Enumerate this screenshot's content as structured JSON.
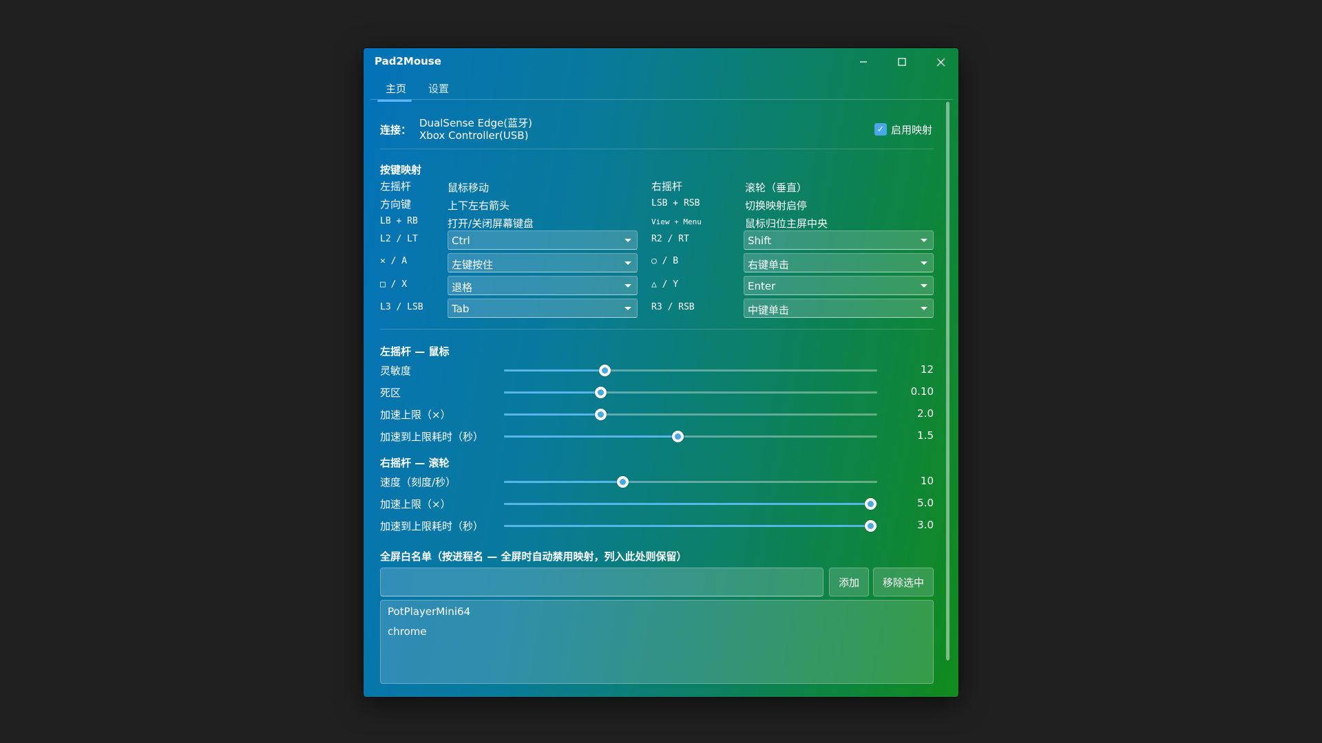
{
  "window": {
    "title": "Pad2Mouse"
  },
  "tabs": [
    {
      "label": "主页"
    },
    {
      "label": "设置"
    }
  ],
  "connection": {
    "label": "连接：",
    "devices": [
      "DualSense Edge(蓝牙)",
      "Xbox Controller(USB)"
    ],
    "enable_label": "启用映射",
    "enabled": true
  },
  "mapping": {
    "title": "按键映射",
    "static": [
      {
        "key": "左摇杆",
        "action": "鼠标移动"
      },
      {
        "key": "方向键",
        "action": "上下左右箭头"
      },
      {
        "key": "LB + RB",
        "action": "打开/关闭屏幕键盘"
      },
      {
        "key": "右摇杆",
        "action": "滚轮（垂直）"
      },
      {
        "key": "LSB + RSB",
        "action": "切换映射启停"
      },
      {
        "key": "View + Menu",
        "action": "鼠标归位主屏中央"
      }
    ],
    "selects": [
      {
        "key": "L2 / LT",
        "value": "Ctrl"
      },
      {
        "key": "✕ / A",
        "value": "左键按住"
      },
      {
        "key": "□ / X",
        "value": "退格"
      },
      {
        "key": "L3 / LSB",
        "value": "Tab"
      },
      {
        "key": "R2 / RT",
        "value": "Shift"
      },
      {
        "key": "○ / B",
        "value": "右键单击"
      },
      {
        "key": "△ / Y",
        "value": "Enter"
      },
      {
        "key": "R3 / RSB",
        "value": "中键单击"
      }
    ]
  },
  "left_stick": {
    "title": "左摇杆 — 鼠标",
    "sliders": [
      {
        "label": "灵敏度",
        "value": "12",
        "fraction": 0.27
      },
      {
        "label": "死区",
        "value": "0.10",
        "fraction": 0.258
      },
      {
        "label": "加速上限（×）",
        "value": "2.0",
        "fraction": 0.258
      },
      {
        "label": "加速到上限耗时（秒）",
        "value": "1.5",
        "fraction": 0.465
      }
    ]
  },
  "right_stick": {
    "title": "右摇杆 — 滚轮",
    "sliders": [
      {
        "label": "速度（刻度/秒）",
        "value": "10",
        "fraction": 0.317
      },
      {
        "label": "加速上限（×）",
        "value": "5.0",
        "fraction": 0.982
      },
      {
        "label": "加速到上限耗时（秒）",
        "value": "3.0",
        "fraction": 0.982
      }
    ]
  },
  "whitelist": {
    "title": "全屏白名单（按进程名 — 全屏时自动禁用映射，列入此处则保留）",
    "input_value": "",
    "add_label": "添加",
    "remove_label": "移除选中",
    "items": [
      "PotPlayerMini64",
      "chrome"
    ]
  },
  "colors": {
    "accent": "#48a8e0",
    "gradient_start": "#0472b8",
    "gradient_end": "#118a1e"
  }
}
